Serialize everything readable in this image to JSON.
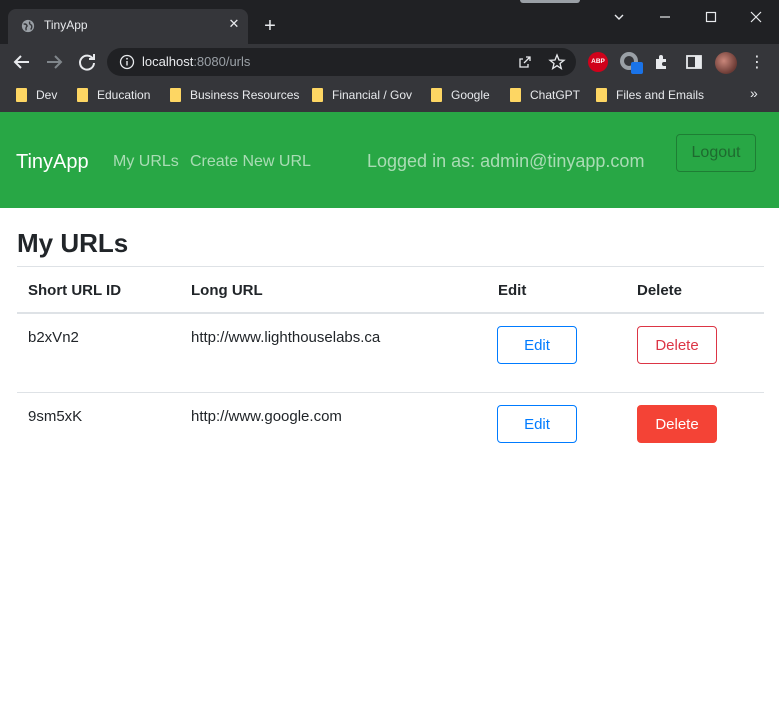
{
  "browser": {
    "tab_title": "TinyApp",
    "url_host": "localhost",
    "url_path": ":8080/urls",
    "bookmarks": [
      "Dev",
      "Education",
      "Business Resources",
      "Financial / Gov",
      "Google",
      "ChatGPT",
      "Files and Emails"
    ],
    "more_label": "»",
    "abp_label": "ABP",
    "colors": {
      "titlebar": "#202124",
      "toolbar": "#35363a",
      "folder": "#fdd663"
    }
  },
  "navbar": {
    "brand": "TinyApp",
    "links": [
      "My URLs",
      "Create New URL"
    ],
    "logged_in": "Logged in as: admin@tinyapp.com",
    "logout_label": "Logout",
    "color": "#28a745"
  },
  "main": {
    "title": "My URLs",
    "columns": [
      "Short URL ID",
      "Long URL",
      "Edit",
      "Delete"
    ],
    "rows": [
      {
        "short_id": "b2xVn2",
        "long_url": "http://www.lighthouselabs.ca",
        "edit_label": "Edit",
        "delete_label": "Delete"
      },
      {
        "short_id": "9sm5xK",
        "long_url": "http://www.google.com",
        "edit_label": "Edit",
        "delete_label": "Delete"
      }
    ]
  }
}
